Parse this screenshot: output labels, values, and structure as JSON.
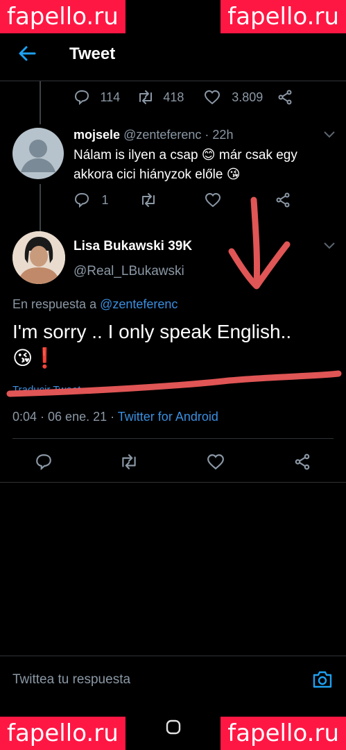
{
  "watermark": "fapello.ru",
  "header": {
    "title": "Tweet"
  },
  "top_stats": {
    "replies": "114",
    "retweets": "418",
    "likes": "3.809"
  },
  "reply1": {
    "name": "mojsele",
    "handle": "@zenteferenc",
    "time": "· 22h",
    "text_line1": "Nálam is ilyen a csap 😊 már csak egy",
    "text_line2": "akkora cici hiányzok előle 😘",
    "replies": "1"
  },
  "main_tweet": {
    "name": "Lisa Bukawski 39K",
    "handle": "@Real_LBukawski",
    "reply_prefix": "En respuesta a",
    "reply_to": "@zenteferenc",
    "text_line1": "I'm sorry .. I only speak English..",
    "text_line2": "😘❗",
    "translate": "Traducir Tweet",
    "timestamp": "0:04 · 06 ene. 21 ·",
    "source": "Twitter for Android"
  },
  "composer": {
    "placeholder": "Twittea tu respuesta"
  },
  "colors": {
    "accent": "#1da1f2",
    "annotation": "#e05555",
    "watermark": "#ff1744"
  },
  "icons": [
    "back-arrow-icon",
    "reply-icon",
    "retweet-icon",
    "like-icon",
    "share-icon",
    "chevron-down-icon",
    "camera-icon",
    "home-button-icon"
  ]
}
